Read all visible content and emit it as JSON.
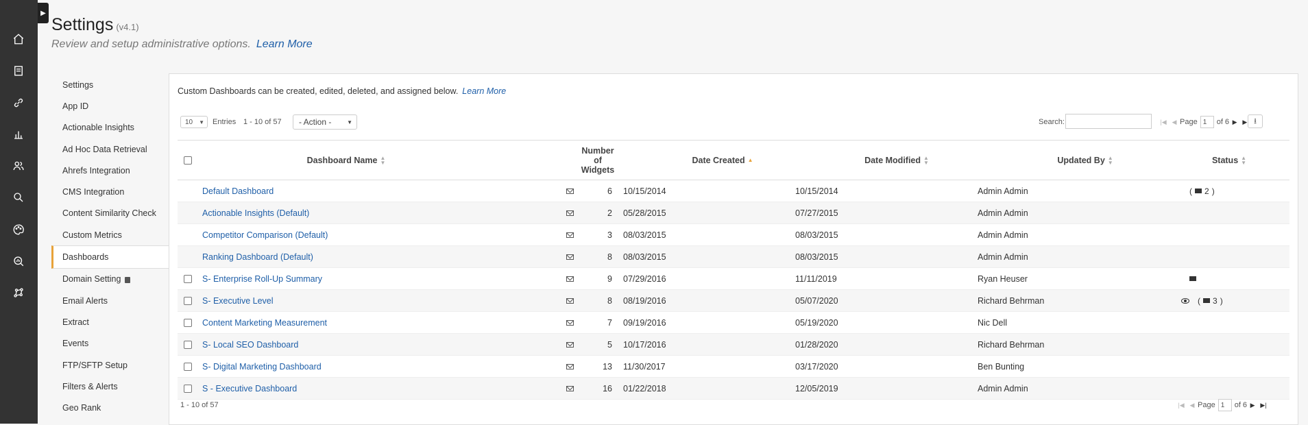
{
  "nav_icons": [
    "home-icon",
    "document-icon",
    "link-icon",
    "bar-chart-icon",
    "users-icon",
    "search-icon",
    "palette-icon",
    "magnify-chart-icon",
    "network-icon"
  ],
  "page": {
    "title": "Settings",
    "version": "(v4.1)",
    "subtitle": "Review and setup administrative options.",
    "learn_more": "Learn More"
  },
  "left_nav": [
    {
      "label": "Settings"
    },
    {
      "label": "App ID"
    },
    {
      "label": "Actionable Insights"
    },
    {
      "label": "Ad Hoc Data Retrieval"
    },
    {
      "label": "Ahrefs Integration"
    },
    {
      "label": "CMS Integration"
    },
    {
      "label": "Content Similarity Check"
    },
    {
      "label": "Custom Metrics"
    },
    {
      "label": "Dashboards",
      "active": true
    },
    {
      "label": "Domain Setting",
      "locked": true
    },
    {
      "label": "Email Alerts"
    },
    {
      "label": "Extract"
    },
    {
      "label": "Events"
    },
    {
      "label": "FTP/SFTP Setup"
    },
    {
      "label": "Filters & Alerts"
    },
    {
      "label": "Geo Rank"
    }
  ],
  "panel": {
    "intro": "Custom Dashboards can be created, edited, deleted, and assigned below.",
    "learn_more": "Learn More",
    "entries_value": "10",
    "entries_label": "Entries",
    "range": "1 - 10 of 57",
    "action_value": "- Action -",
    "search_label": "Search:",
    "search_value": "",
    "page_label": "Page",
    "page_value": "1",
    "page_of": "of 6",
    "footer_range": "1 - 10 of 57"
  },
  "columns": {
    "name": "Dashboard Name",
    "widgets": "Number of Widgets",
    "created": "Date Created",
    "modified": "Date Modified",
    "updated_by": "Updated By",
    "status": "Status"
  },
  "rows": [
    {
      "name": "Default Dashboard",
      "checkbox": false,
      "widgets": "6",
      "created": "10/15/2014",
      "modified": "10/15/2014",
      "updated_by": "Admin Admin",
      "status": {
        "eye": false,
        "mail": true,
        "paren": true,
        "count": "2"
      }
    },
    {
      "name": "Actionable Insights (Default)",
      "checkbox": false,
      "widgets": "2",
      "created": "05/28/2015",
      "modified": "07/27/2015",
      "updated_by": "Admin Admin",
      "status": null
    },
    {
      "name": "Competitor Comparison (Default)",
      "checkbox": false,
      "widgets": "3",
      "created": "08/03/2015",
      "modified": "08/03/2015",
      "updated_by": "Admin Admin",
      "status": null
    },
    {
      "name": "Ranking Dashboard (Default)",
      "checkbox": false,
      "widgets": "8",
      "created": "08/03/2015",
      "modified": "08/03/2015",
      "updated_by": "Admin Admin",
      "status": null
    },
    {
      "name": "S- Enterprise Roll-Up Summary",
      "checkbox": true,
      "widgets": "9",
      "created": "07/29/2016",
      "modified": "11/11/2019",
      "updated_by": "Ryan Heuser",
      "status": {
        "eye": false,
        "mail": true,
        "paren": false,
        "count": ""
      }
    },
    {
      "name": "S- Executive Level",
      "checkbox": true,
      "widgets": "8",
      "created": "08/19/2016",
      "modified": "05/07/2020",
      "updated_by": "Richard Behrman",
      "status": {
        "eye": true,
        "mail": true,
        "paren": true,
        "count": "3"
      }
    },
    {
      "name": "Content Marketing Measurement",
      "checkbox": true,
      "widgets": "7",
      "created": "09/19/2016",
      "modified": "05/19/2020",
      "updated_by": "Nic Dell",
      "status": null
    },
    {
      "name": "S- Local SEO Dashboard",
      "checkbox": true,
      "widgets": "5",
      "created": "10/17/2016",
      "modified": "01/28/2020",
      "updated_by": "Richard Behrman",
      "status": null
    },
    {
      "name": "S- Digital Marketing Dashboard",
      "checkbox": true,
      "widgets": "13",
      "created": "11/30/2017",
      "modified": "03/17/2020",
      "updated_by": "Ben Bunting",
      "status": null
    },
    {
      "name": "S - Executive Dashboard",
      "checkbox": true,
      "widgets": "16",
      "created": "01/22/2018",
      "modified": "12/05/2019",
      "updated_by": "Admin Admin",
      "status": null
    }
  ]
}
